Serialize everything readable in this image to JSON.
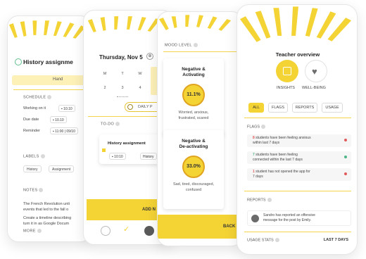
{
  "colors": {
    "accent": "#f4d335",
    "accent_light": "#fdf1b8",
    "red": "#e25b5b",
    "green": "#4fb487"
  },
  "phone1": {
    "title": "History assignme",
    "tab": "Hand",
    "schedule_label": "SCHEDULE",
    "rows": [
      {
        "label": "Working on it",
        "value": "10.10"
      },
      {
        "label": "Due date",
        "value": "10.10"
      },
      {
        "label": "Reminder",
        "value": "11:00 | 09/10"
      }
    ],
    "labels_label": "LABELS",
    "tags": [
      "History",
      "Assignment"
    ],
    "notes_label": "NOTES",
    "notes": [
      "The French Revolution unti",
      "events that led to the fall o",
      "Create a timeline describing",
      "turn it in as Google Docum"
    ],
    "more_label": "MORE"
  },
  "phone2": {
    "date": "Thursday, Nov 5",
    "calendar": [
      {
        "day": "M",
        "num": "2"
      },
      {
        "day": "T",
        "num": "3"
      },
      {
        "day": "W",
        "num": "4"
      }
    ],
    "pill": "DAILY P",
    "todo_label": "TO-DO",
    "card_title": "History assignment",
    "card_time": "10:10",
    "card_tag": "History",
    "add_label": "ADD N"
  },
  "phone3": {
    "mood_label": "MOOD LEVEL",
    "cards": [
      {
        "title_line1": "Negative &",
        "title_line2": "Activating",
        "percent": "11.1%",
        "desc_line1": "Worried, anxious,",
        "desc_line2": "frustrated, scared"
      },
      {
        "title_line1": "Negative &",
        "title_line2": "De-activating",
        "percent": "33.0%",
        "desc_line1": "Sad, tired, discouraged,",
        "desc_line2": "confused"
      }
    ],
    "back_label": "BACK"
  },
  "phone4": {
    "title": "Teacher overview",
    "tiles": [
      "INSIGHTS",
      "WELL-BEING"
    ],
    "tabs": [
      "ALL",
      "FLAGS",
      "REPORTS",
      "USAGE"
    ],
    "flags_label": "FLAGS",
    "flags": [
      {
        "count": "8",
        "text1": "students have been feeling anxious",
        "text2": "within last 7 days",
        "status": "red"
      },
      {
        "count": "7",
        "text1": "students have been feeling",
        "text2": "connected within the last 7 days",
        "status": "green"
      },
      {
        "count": "1",
        "text1": "student has not opened the app for",
        "text2": "7 days",
        "status": "red"
      }
    ],
    "reports_label": "REPORTS",
    "report_text1": "Sandro has reported an offensive",
    "report_text2": "message for the post by Emily.",
    "usage_label": "USAGE STATS",
    "usage_range": "LAST 7 DAYS"
  }
}
